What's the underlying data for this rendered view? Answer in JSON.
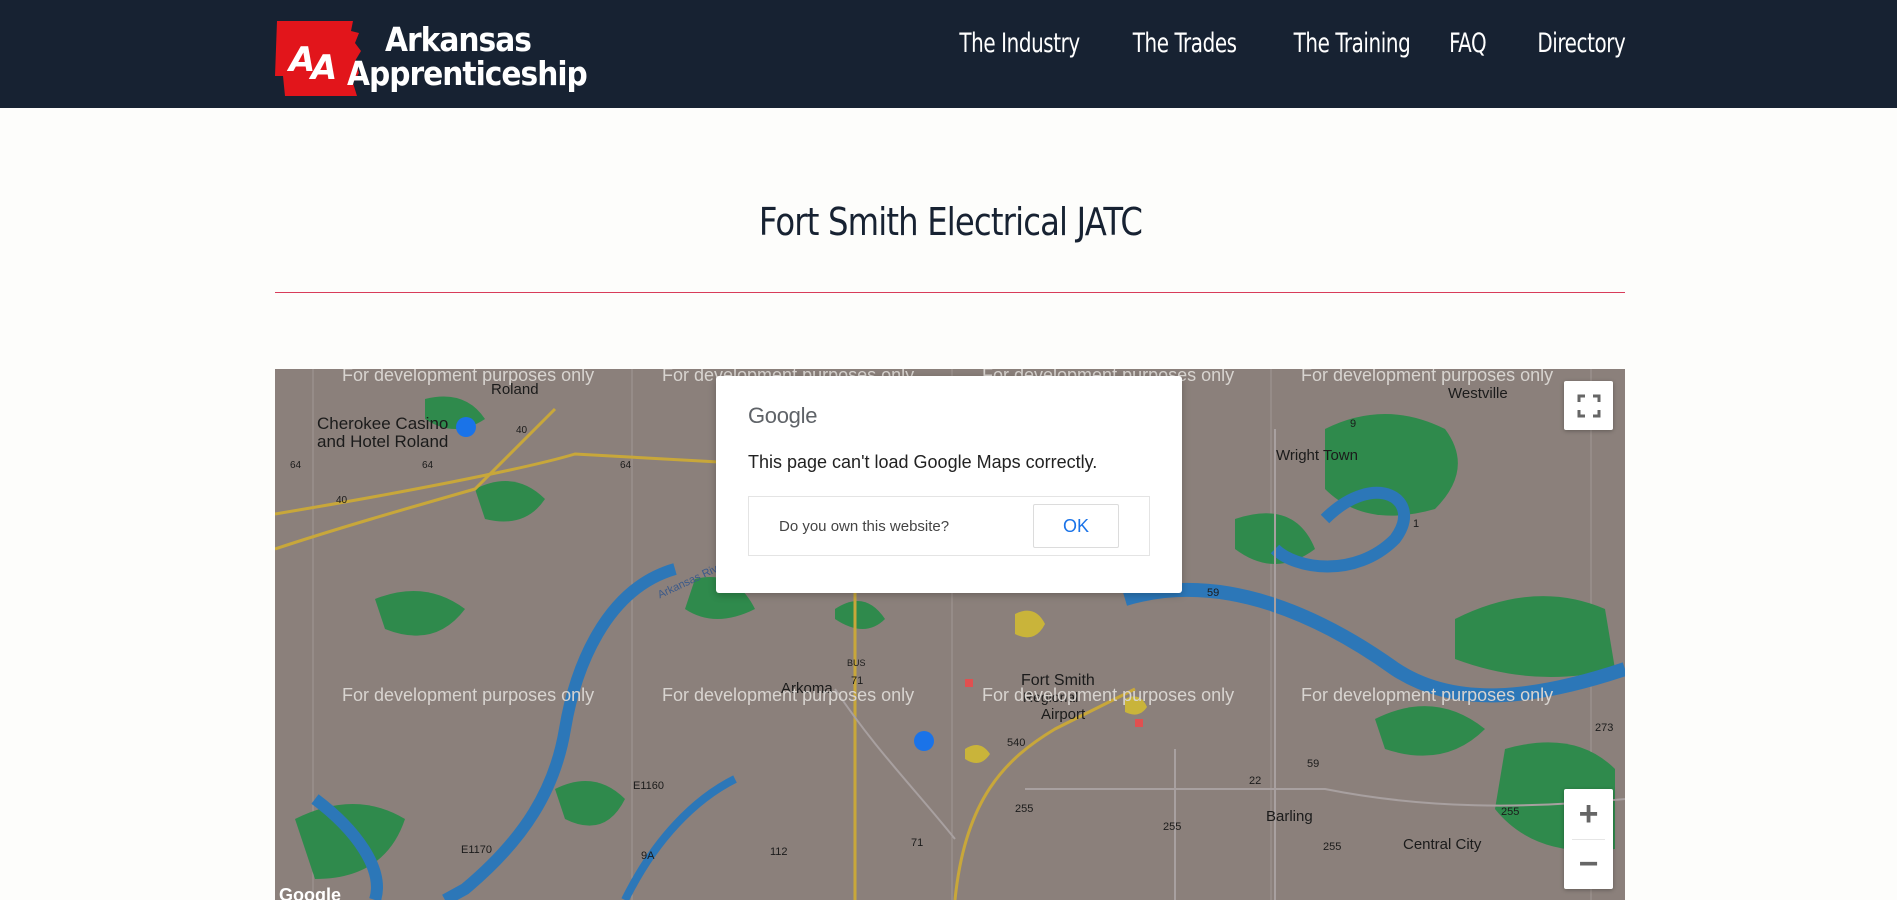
{
  "header": {
    "logo_line1": "Arkansas",
    "logo_line2": "Apprenticeship",
    "nav": [
      "The Industry",
      "The Trades",
      "The Training",
      "FAQ",
      "Directory"
    ]
  },
  "page": {
    "title": "Fort Smith Electrical JATC"
  },
  "map": {
    "watermark": "For development purposes only",
    "labels": {
      "roland": "Roland",
      "cherokee": "Cherokee Casino",
      "hotel": "and Hotel Roland",
      "westville": "Westville",
      "wright_town": "Wright Town",
      "arkansas_river": "Arkansas River",
      "arkoma": "Arkoma",
      "fort_smith": "Fort Smith",
      "regional": "Regional",
      "airport": "Airport",
      "barling": "Barling",
      "central_city": "Central City",
      "e1160": "E1160",
      "e1170": "E1170",
      "r9": "9",
      "r1": "1",
      "r273": "273",
      "r59a": "59",
      "r59b": "59",
      "r22": "22",
      "r255a": "255",
      "r255b": "255",
      "r255c": "255",
      "r255d": "255",
      "r112": "112",
      "r9a": "9A",
      "r540": "540",
      "bus71a": "71",
      "bus71b": "71",
      "r64a": "64",
      "r64b": "64",
      "r64c": "64",
      "r40a": "40",
      "r40b": "40",
      "bus": "BUS",
      "google": "Google"
    },
    "dialog": {
      "brand": "Google",
      "message": "This page can't load Google Maps correctly.",
      "own_link": "Do you own this website?",
      "ok_label": "OK"
    },
    "controls": {
      "zoom_in": "+",
      "zoom_out": "−"
    }
  }
}
